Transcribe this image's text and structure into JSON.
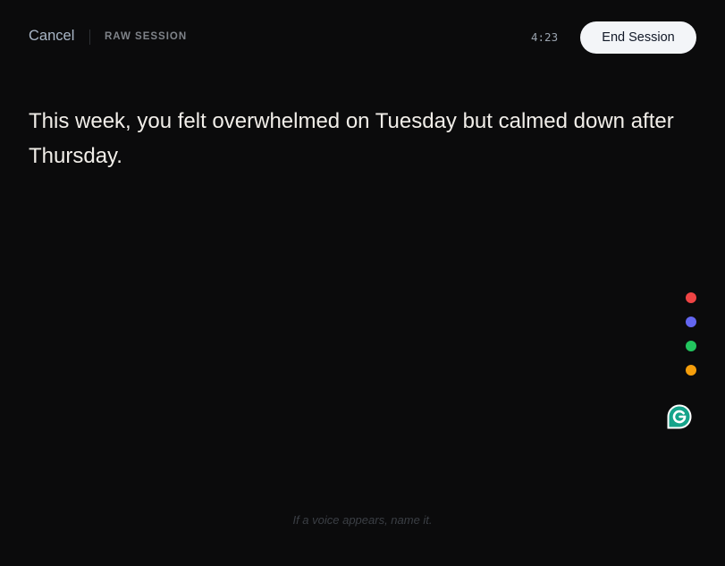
{
  "header": {
    "cancel_label": "Cancel",
    "session_label": "RAW SESSION",
    "timer": "4:23",
    "end_label": "End Session"
  },
  "entry": {
    "text": "This week, you felt overwhelmed on Tuesday but calmed down after Thursday."
  },
  "color_dots": [
    {
      "name": "red",
      "color": "#ef4444"
    },
    {
      "name": "indigo",
      "color": "#6366f1"
    },
    {
      "name": "green",
      "color": "#22c55e"
    },
    {
      "name": "amber",
      "color": "#f59e0b"
    }
  ],
  "widget": {
    "icon": "grammarly-icon",
    "color": "#15a38a"
  },
  "footer": {
    "hint": "If a voice appears, name it."
  }
}
